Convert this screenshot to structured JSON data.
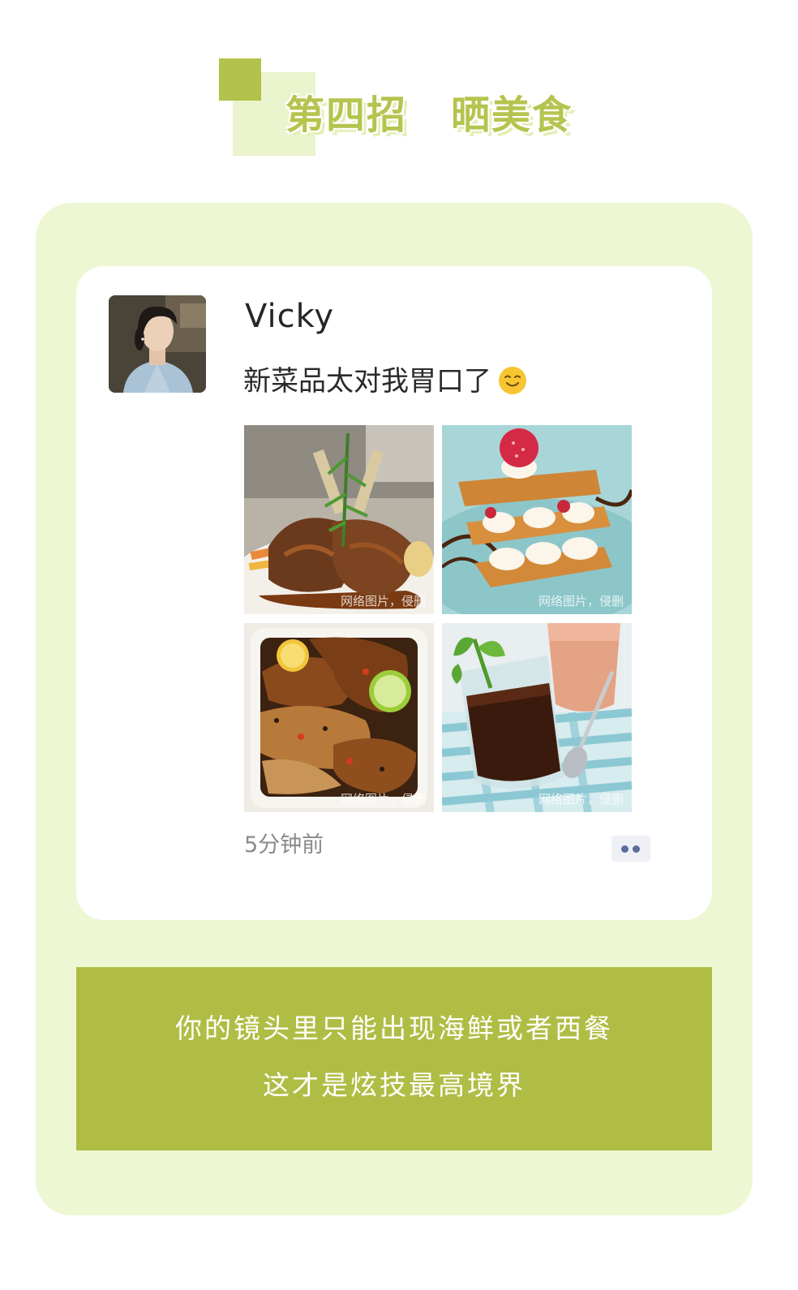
{
  "heading": {
    "part1": "第四招",
    "part2": "晒美食"
  },
  "post": {
    "username": "Vicky",
    "text": "新菜品太对我胃口了",
    "emoji": "smiling-face-icon",
    "time": "5分钟前",
    "photos": [
      {
        "subject": "grilled-lamb-chops",
        "watermark": "网络图片，侵删"
      },
      {
        "subject": "raspberry-mille-feuille",
        "watermark": "网络图片，侵删"
      },
      {
        "subject": "roasted-chicken-lemon",
        "watermark": "网络图片，侵删"
      },
      {
        "subject": "chocolate-drink-juice",
        "watermark": "网络图片，侵删"
      }
    ]
  },
  "caption": {
    "line1": "你的镜头里只能出现海鲜或者西餐",
    "line2": "这才是炫技最高境界"
  },
  "colors": {
    "accent": "#b0bd45",
    "panel": "#eef7d3",
    "heading": "#b5c44e"
  }
}
